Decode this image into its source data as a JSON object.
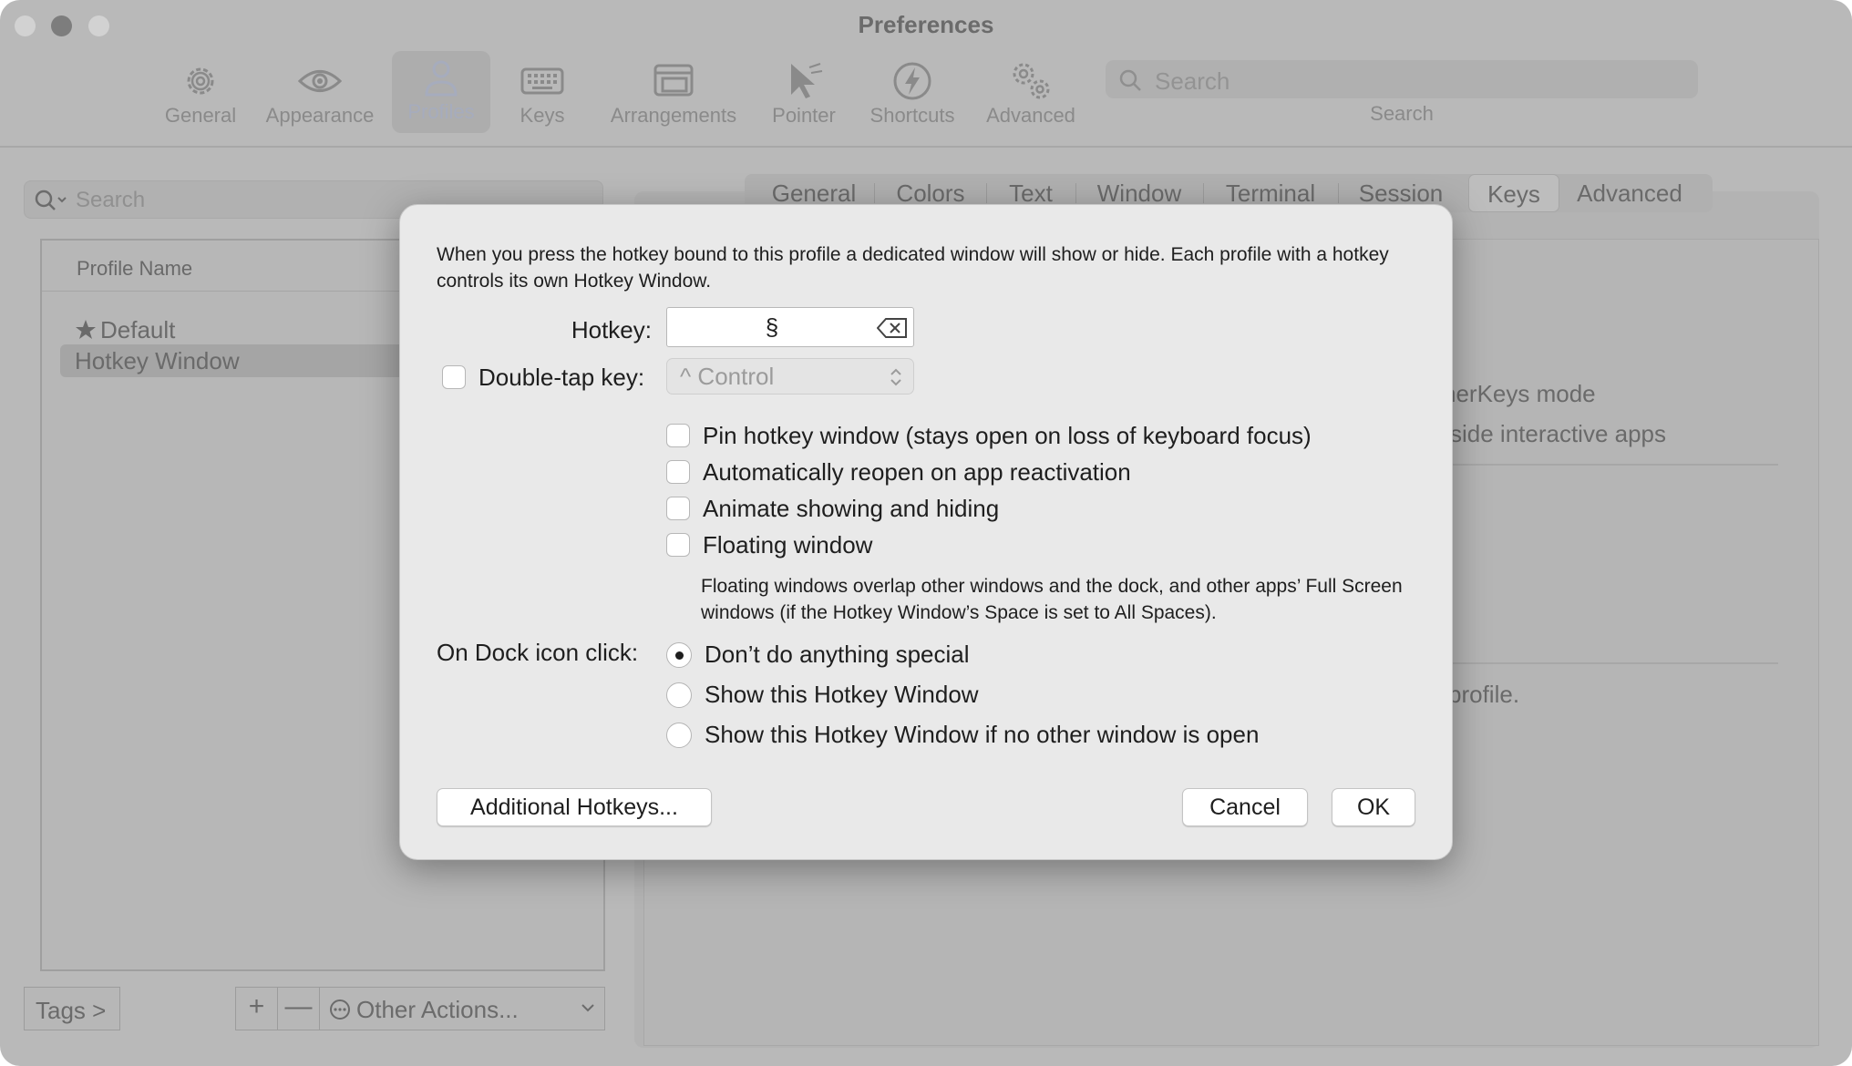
{
  "window": {
    "title": "Preferences"
  },
  "toolbar": {
    "items": [
      {
        "label": "General",
        "icon": "gear-icon"
      },
      {
        "label": "Appearance",
        "icon": "eye-icon"
      },
      {
        "label": "Profiles",
        "icon": "person-icon",
        "selected": true
      },
      {
        "label": "Keys",
        "icon": "keyboard-icon"
      },
      {
        "label": "Arrangements",
        "icon": "window-stack-icon"
      },
      {
        "label": "Pointer",
        "icon": "pointer-icon"
      },
      {
        "label": "Shortcuts",
        "icon": "lightning-icon"
      },
      {
        "label": "Advanced",
        "icon": "gears-icon"
      }
    ],
    "search_placeholder": "Search",
    "search_caption": "Search"
  },
  "left": {
    "search_placeholder": "Search",
    "table_header": "Profile Name",
    "profiles": [
      "Default",
      "Hotkey Window"
    ],
    "tags_label": "Tags >",
    "add_label": "+",
    "remove_label": "—",
    "other_actions_label": "Other Actions..."
  },
  "tabs": [
    "General",
    "Colors",
    "Text",
    "Window",
    "Terminal",
    "Session",
    "Keys",
    "Advanced"
  ],
  "background_fragments": [
    "nerKeys mode",
    "side interactive apps",
    "profile."
  ],
  "dialog": {
    "description": "When you press the hotkey bound to this profile a dedicated window will show or hide. Each profile with a hotkey controls its own Hotkey Window.",
    "hotkey_label": "Hotkey:",
    "hotkey_value": "§",
    "double_tap_label": "Double-tap key:",
    "double_tap_value": "^ Control",
    "options": [
      "Pin hotkey window (stays open on loss of keyboard focus)",
      "Automatically reopen on app reactivation",
      "Animate showing and hiding",
      "Floating window"
    ],
    "floating_note": "Floating windows overlap other windows and the dock, and other apps’ Full Screen windows (if the Hotkey Window’s Space is set to All Spaces).",
    "dock_label": "On Dock icon click:",
    "dock_options": [
      "Don’t do anything special",
      "Show this Hotkey Window",
      "Show this Hotkey Window if no other window is open"
    ],
    "additional_hotkeys_label": "Additional Hotkeys...",
    "cancel_label": "Cancel",
    "ok_label": "OK"
  }
}
